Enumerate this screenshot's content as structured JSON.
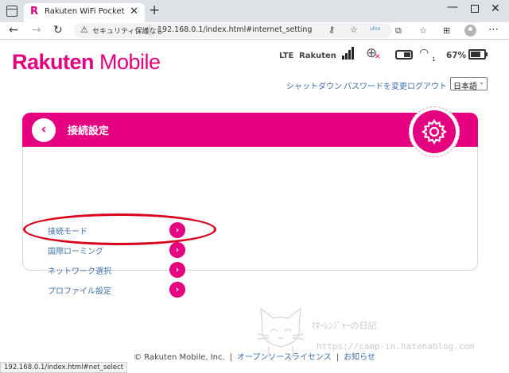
{
  "browser": {
    "tab_title": "Rakuten WiFi Pocket",
    "favicon": "R",
    "security_label": "セキュリティ保護なし",
    "url": "192.168.0.1/index.html#internet_setting",
    "status_url": "192.168.0.1/index.html#net_select",
    "extension_badge": "ufoo"
  },
  "header": {
    "logo_brand": "Rakuten",
    "logo_suffix": " Mobile",
    "network_type": "LTE",
    "carrier": "Rakuten",
    "battery_percent": "67%",
    "battery_level": 0.67,
    "wifi_clients": "1",
    "links": {
      "shutdown": "シャットダウン",
      "change_password": "パスワードを変更",
      "logout": "ログアウト"
    },
    "language": "日本語"
  },
  "card": {
    "title": "接続設定",
    "items": [
      {
        "label": "接続モード"
      },
      {
        "label": "国際ローミング"
      },
      {
        "label": "ネットワーク選択"
      },
      {
        "label": "プロファイル設定"
      }
    ],
    "arrow_glyph": "›",
    "back_glyph": "‹"
  },
  "footer": {
    "copyright": "© Rakuten Mobile, Inc.",
    "oss_license": "オープンソースライセンス",
    "notice": "お知らせ"
  },
  "watermark": {
    "text": "ﾏﾈｰﾚﾝｼﾞｬｰの日記",
    "url": "https://camp-in.hatenablog.com"
  },
  "colors": {
    "brand": "#e4007f",
    "link": "#3f6fa8",
    "annotation": "#d8001a"
  }
}
